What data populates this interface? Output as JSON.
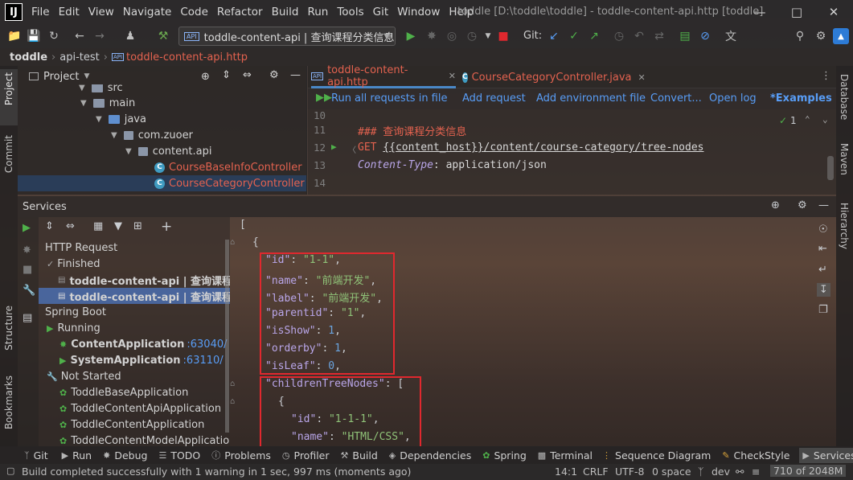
{
  "app": {
    "logo_text": "IJ",
    "menu": [
      "File",
      "Edit",
      "View",
      "Navigate",
      "Code",
      "Refactor",
      "Build",
      "Run",
      "Tools",
      "Git",
      "Window",
      "Help"
    ],
    "window_title": "toddle [D:\\toddle\\toddle] - toddle-content-api.http [toddle]"
  },
  "toolbar": {
    "run_config": "toddle-content-api | 查询课程分类信息",
    "git_label": "Git:"
  },
  "breadcrumb": [
    "toddle",
    "api-test",
    "toddle-content-api.http"
  ],
  "left_strip": {
    "project": "Project",
    "commit": "Commit",
    "structure": "Structure",
    "bookmarks": "Bookmarks"
  },
  "right_strip": {
    "database": "Database",
    "maven": "Maven",
    "hierarchy": "Hierarchy"
  },
  "project_pane": {
    "title": "Project",
    "rows": [
      {
        "label": "src",
        "kind": "folder"
      },
      {
        "label": "main",
        "kind": "folder"
      },
      {
        "label": "java",
        "kind": "folder"
      },
      {
        "label": "com.zuoer",
        "kind": "package"
      },
      {
        "label": "content.api",
        "kind": "package"
      },
      {
        "label": "CourseBaseInfoController",
        "kind": "class"
      },
      {
        "label": "CourseCategoryController",
        "kind": "class"
      }
    ]
  },
  "editor": {
    "tabs": [
      {
        "label": "toddle-content-api.http",
        "icon": "API",
        "active": true
      },
      {
        "label": "CourseCategoryController.java",
        "icon": "C",
        "active": false
      }
    ],
    "http_toolbar": {
      "run_all": "Run all requests in file",
      "add_request": "Add request",
      "add_env": "Add environment file",
      "convert": "Convert...",
      "open_log": "Open log",
      "examples": "*Examples"
    },
    "inspection_count": "1",
    "line_numbers": [
      "10",
      "11",
      "12",
      "13",
      "14"
    ],
    "lines": [
      {
        "ln": "11",
        "parts": [
          {
            "t": "### 查询课程分类信息",
            "c": "comment"
          }
        ]
      },
      {
        "ln": "12",
        "parts": [
          {
            "t": "GET ",
            "c": "kw"
          },
          {
            "t": "{{content_host}}/content/course-category/tree-nodes",
            "c": "url"
          }
        ]
      },
      {
        "ln": "13",
        "parts": [
          {
            "t": "Content-Type",
            "c": "hdr"
          },
          {
            "t": ": application/json",
            "c": "val"
          }
        ]
      }
    ]
  },
  "services": {
    "title": "Services",
    "tree": [
      {
        "label": "HTTP Request",
        "bold": false,
        "indent": 0
      },
      {
        "label": "Finished",
        "bold": false,
        "indent": 1
      },
      {
        "label": "toddle-content-api | 查询课程信",
        "bold": true,
        "indent": 2
      },
      {
        "label": "toddle-content-api | 查询课程分",
        "bold": true,
        "indent": 2,
        "selected": true
      },
      {
        "label": "Spring Boot",
        "bold": false,
        "indent": 0
      },
      {
        "label": "Running",
        "bold": false,
        "indent": 1
      },
      {
        "label": "ContentApplication",
        "suffix": ":63040/",
        "bold": true,
        "indent": 2
      },
      {
        "label": "SystemApplication",
        "suffix": ":63110/",
        "bold": true,
        "indent": 2
      },
      {
        "label": "Not Started",
        "bold": false,
        "indent": 1
      },
      {
        "label": "ToddleBaseApplication",
        "bold": false,
        "indent": 2
      },
      {
        "label": "ToddleContentApiApplication",
        "bold": false,
        "indent": 2
      },
      {
        "label": "ToddleContentApplication",
        "bold": false,
        "indent": 2
      },
      {
        "label": "ToddleContentModelApplication",
        "bold": false,
        "indent": 2
      }
    ],
    "json_lines": [
      {
        "indent": 0,
        "parts": [
          [
            "[",
            "p"
          ]
        ]
      },
      {
        "indent": 1,
        "parts": [
          [
            "{",
            "p"
          ]
        ]
      },
      {
        "indent": 2,
        "parts": [
          [
            "\"id\"",
            "k"
          ],
          [
            ": ",
            "p"
          ],
          [
            "\"1-1\"",
            "s"
          ],
          [
            ",",
            "p"
          ]
        ]
      },
      {
        "indent": 2,
        "parts": [
          [
            "\"name\"",
            "k"
          ],
          [
            ": ",
            "p"
          ],
          [
            "\"前端开发\"",
            "s"
          ],
          [
            ",",
            "p"
          ]
        ]
      },
      {
        "indent": 2,
        "parts": [
          [
            "\"label\"",
            "k"
          ],
          [
            ": ",
            "p"
          ],
          [
            "\"前端开发\"",
            "s"
          ],
          [
            ",",
            "p"
          ]
        ]
      },
      {
        "indent": 2,
        "parts": [
          [
            "\"parentid\"",
            "k"
          ],
          [
            ": ",
            "p"
          ],
          [
            "\"1\"",
            "s"
          ],
          [
            ",",
            "p"
          ]
        ]
      },
      {
        "indent": 2,
        "parts": [
          [
            "\"isShow\"",
            "k"
          ],
          [
            ": ",
            "p"
          ],
          [
            "1",
            "n"
          ],
          [
            ",",
            "p"
          ]
        ]
      },
      {
        "indent": 2,
        "parts": [
          [
            "\"orderby\"",
            "k"
          ],
          [
            ": ",
            "p"
          ],
          [
            "1",
            "n"
          ],
          [
            ",",
            "p"
          ]
        ]
      },
      {
        "indent": 2,
        "parts": [
          [
            "\"isLeaf\"",
            "k"
          ],
          [
            ": ",
            "p"
          ],
          [
            "0",
            "n"
          ],
          [
            ",",
            "p"
          ]
        ]
      },
      {
        "indent": 2,
        "parts": [
          [
            "\"childrenTreeNodes\"",
            "k"
          ],
          [
            ": [",
            "p"
          ]
        ]
      },
      {
        "indent": 3,
        "parts": [
          [
            "{",
            "p"
          ]
        ]
      },
      {
        "indent": 4,
        "parts": [
          [
            "\"id\"",
            "k"
          ],
          [
            ": ",
            "p"
          ],
          [
            "\"1-1-1\"",
            "s"
          ],
          [
            ",",
            "p"
          ]
        ]
      },
      {
        "indent": 4,
        "parts": [
          [
            "\"name\"",
            "k"
          ],
          [
            ": ",
            "p"
          ],
          [
            "\"HTML/CSS\"",
            "s"
          ],
          [
            ",",
            "p"
          ]
        ]
      }
    ]
  },
  "bottom_tabs": [
    "Git",
    "Run",
    "Debug",
    "TODO",
    "Problems",
    "Profiler",
    "Build",
    "Dependencies",
    "Spring",
    "Terminal",
    "Sequence Diagram",
    "CheckStyle",
    "Services"
  ],
  "status": {
    "message": "Build completed successfully with 1 warning in 1 sec, 997 ms (moments ago)",
    "position": "14:1",
    "line_sep": "CRLF",
    "encoding": "UTF-8",
    "indent": "0 space",
    "branch": "dev",
    "memory": "710 of 2048M"
  },
  "colors": {
    "accent": "#589df6",
    "highlight_box": "#e0282e",
    "selection": "#4b6eaf",
    "run_green": "#4fb04a"
  }
}
